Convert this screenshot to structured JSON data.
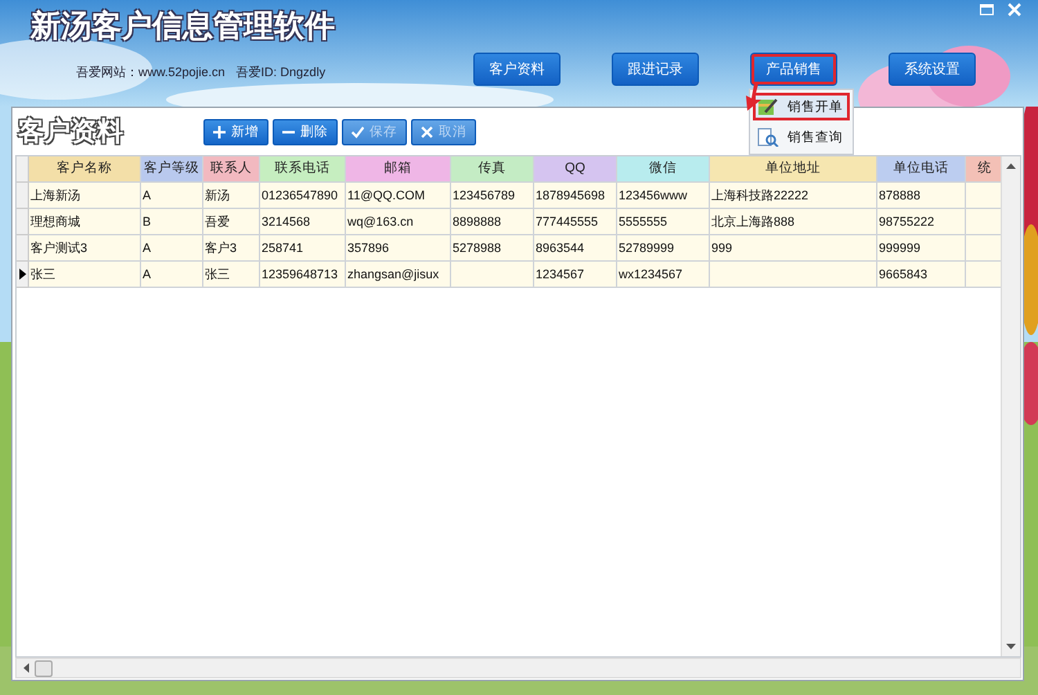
{
  "window": {
    "title": "新汤客户信息管理软件",
    "site": "吾爱网站：www.52pojie.cn",
    "user_id": "吾爱ID: Dngzdly"
  },
  "nav": [
    {
      "label": "客户资料",
      "highlighted": false
    },
    {
      "label": "跟进记录",
      "highlighted": false
    },
    {
      "label": "产品销售",
      "highlighted": true
    },
    {
      "label": "系统设置",
      "highlighted": false
    }
  ],
  "menu": {
    "items": [
      {
        "label": "销售开单",
        "kind": "edit",
        "highlighted": true
      },
      {
        "label": "销售查询",
        "kind": "search",
        "highlighted": false
      }
    ]
  },
  "panel": {
    "title": "客户资料",
    "toolbar": [
      {
        "label": "新增",
        "kind": "plus",
        "disabled": false
      },
      {
        "label": "删除",
        "kind": "minus",
        "disabled": false
      },
      {
        "label": "保存",
        "kind": "check",
        "disabled": true
      },
      {
        "label": "取消",
        "kind": "cross",
        "disabled": true
      }
    ]
  },
  "table": {
    "columns": [
      {
        "label": "客户名称",
        "color": "#f3dfa8"
      },
      {
        "label": "客户等级",
        "color": "#b9c9ee"
      },
      {
        "label": "联系人",
        "color": "#f2b9c0"
      },
      {
        "label": "联系电话",
        "color": "#c6eec0"
      },
      {
        "label": "邮箱",
        "color": "#efb6e6"
      },
      {
        "label": "传真",
        "color": "#c4ecc4"
      },
      {
        "label": "QQ",
        "color": "#d5c4f0"
      },
      {
        "label": "微信",
        "color": "#b8ecee"
      },
      {
        "label": "单位地址",
        "color": "#f6e6b0"
      },
      {
        "label": "单位电话",
        "color": "#bccdf0"
      },
      {
        "label": "统",
        "color": "#f3c0b6"
      }
    ],
    "rows": [
      {
        "current": false,
        "cells": [
          "上海新汤",
          "A",
          "新汤",
          "01236547890",
          "11@QQ.COM",
          "123456789",
          "1878945698",
          "123456www",
          "上海科技路22222",
          "878888",
          ""
        ]
      },
      {
        "current": false,
        "cells": [
          "理想商城",
          "B",
          "吾爱",
          "3214568",
          "wq@163.cn",
          "8898888",
          "777445555",
          "5555555",
          "北京上海路888",
          "98755222",
          ""
        ]
      },
      {
        "current": false,
        "cells": [
          "客户测试3",
          "A",
          "客户3",
          "258741",
          "357896",
          "5278988",
          "8963544",
          "52789999",
          "999",
          "999999",
          ""
        ]
      },
      {
        "current": true,
        "cells": [
          "张三",
          "A",
          "张三",
          "12359648713",
          "zhangsan@jisux",
          "",
          "1234567",
          "wx1234567",
          "",
          "9665843",
          ""
        ]
      }
    ]
  }
}
